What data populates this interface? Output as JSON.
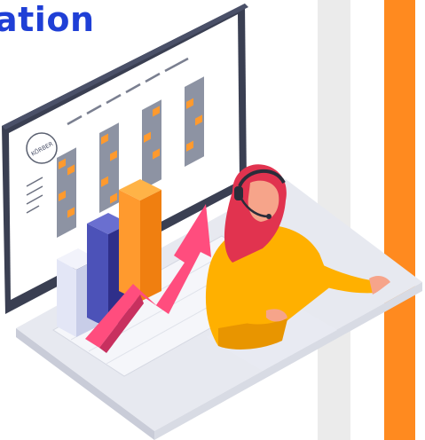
{
  "heading": {
    "text": "ation"
  },
  "screen": {
    "logo_text": "KÖRBER"
  },
  "colors": {
    "brand_blue": "#1f3fd6",
    "accent_orange": "#ff8a1f",
    "stripe_gray": "#ebebeb",
    "monitor_dark": "#3a3f52"
  }
}
